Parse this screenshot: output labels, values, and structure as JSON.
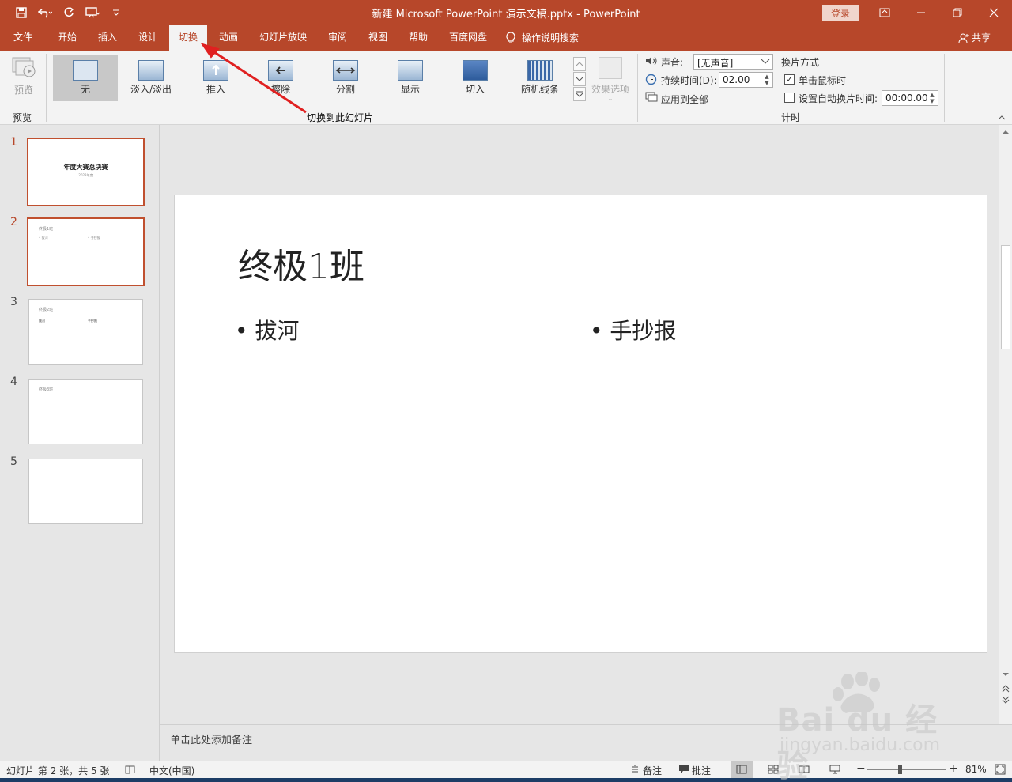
{
  "title_bar": {
    "document_title": "新建 Microsoft PowerPoint 演示文稿.pptx  -  PowerPoint",
    "login_label": "登录"
  },
  "tabs": [
    {
      "label": "文件"
    },
    {
      "label": "开始"
    },
    {
      "label": "插入"
    },
    {
      "label": "设计"
    },
    {
      "label": "切换",
      "active": true
    },
    {
      "label": "动画"
    },
    {
      "label": "幻灯片放映"
    },
    {
      "label": "审阅"
    },
    {
      "label": "视图"
    },
    {
      "label": "帮助"
    },
    {
      "label": "百度网盘"
    },
    {
      "label": "操作说明搜索"
    }
  ],
  "share_label": "共享",
  "ribbon": {
    "preview_button": "预览",
    "preview_group": "预览",
    "transitions": [
      "无",
      "淡入/淡出",
      "推入",
      "擦除",
      "分割",
      "显示",
      "切入",
      "随机线条"
    ],
    "transition_group": "切换到此幻灯片",
    "effect_options": "效果选项",
    "sound_label": "声音:",
    "sound_value": "[无声音]",
    "duration_label": "持续时间(D):",
    "duration_value": "02.00",
    "apply_all": "应用到全部",
    "advance_heading": "换片方式",
    "on_click": "单击鼠标时",
    "auto_after": "设置自动换片时间:",
    "auto_value": "00:00.00",
    "timing_group": "计时"
  },
  "thumbnails": [
    {
      "num": "1",
      "title": "年度大赛总决赛",
      "subtitle": "2023年度"
    },
    {
      "num": "2",
      "title": "终极1班",
      "b1": "• 拔河",
      "b2": "• 手抄报"
    },
    {
      "num": "3",
      "title": "终极2班",
      "b1": "拔河",
      "b2": "手抄报"
    },
    {
      "num": "4",
      "title": "终极3班"
    },
    {
      "num": "5"
    }
  ],
  "slide": {
    "title": "终极1班",
    "bullets": [
      "• 拔河",
      "• 手抄报"
    ]
  },
  "notes_placeholder": "单击此处添加备注",
  "status": {
    "slide_info": "幻灯片 第 2 张，共 5 张",
    "language": "中文(中国)",
    "notes": "备注",
    "comments": "批注",
    "zoom": "81%",
    "zoom_fraction": 0.81
  },
  "watermark": {
    "brand": "Bai du 经验",
    "url": "jingyan.baidu.com"
  },
  "colors": {
    "accent": "#b7472a",
    "selection_border": "#c0502f",
    "annotation_arrow": "#e02020"
  }
}
